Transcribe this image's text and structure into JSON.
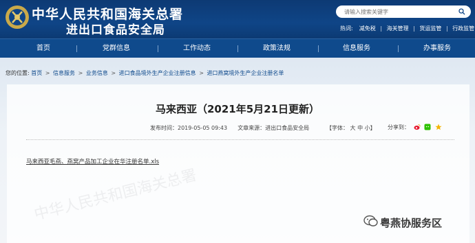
{
  "header": {
    "title_line1": "中华人民共和国海关总署",
    "title_line2": "进出口食品安全局",
    "search_placeholder": "请输入搜索关键字",
    "hot_label": "热词:",
    "hot_words": [
      "减免税",
      "海关管理",
      "货运监管",
      "行政监管"
    ]
  },
  "nav": {
    "items": [
      "首页",
      "党群信息",
      "工作动态",
      "政策法规",
      "信息服务",
      "办事服务"
    ]
  },
  "breadcrumb": {
    "label": "您的位置:",
    "crumbs": [
      "首页",
      "信息服务",
      "业务信息",
      "进口食品境外生产企业注册信息",
      "进口燕窝境外生产企业注册名单"
    ]
  },
  "article": {
    "title": "马来西亚（2021年5月21日更新）",
    "publish_label": "发布时间：",
    "publish_time": "2019-05-05 09:43",
    "source_label": "文章来源：",
    "source": "进出口食品安全局",
    "fontsize_label": "【字体：",
    "fontsize_large": "大",
    "fontsize_medium": "中",
    "fontsize_small": "小",
    "fontsize_end": "】",
    "share_label": "分享到：",
    "attachment": "马来西亚毛燕、燕窝产品加工企业在华注册名单.xls"
  },
  "watermark": {
    "text": "中华人民共和国海关总署",
    "badge_text": "粤燕协服务区"
  },
  "colors": {
    "header_bg": "#0f4587",
    "nav_bg": "#0f4a8c",
    "link": "#0f4a8c"
  }
}
